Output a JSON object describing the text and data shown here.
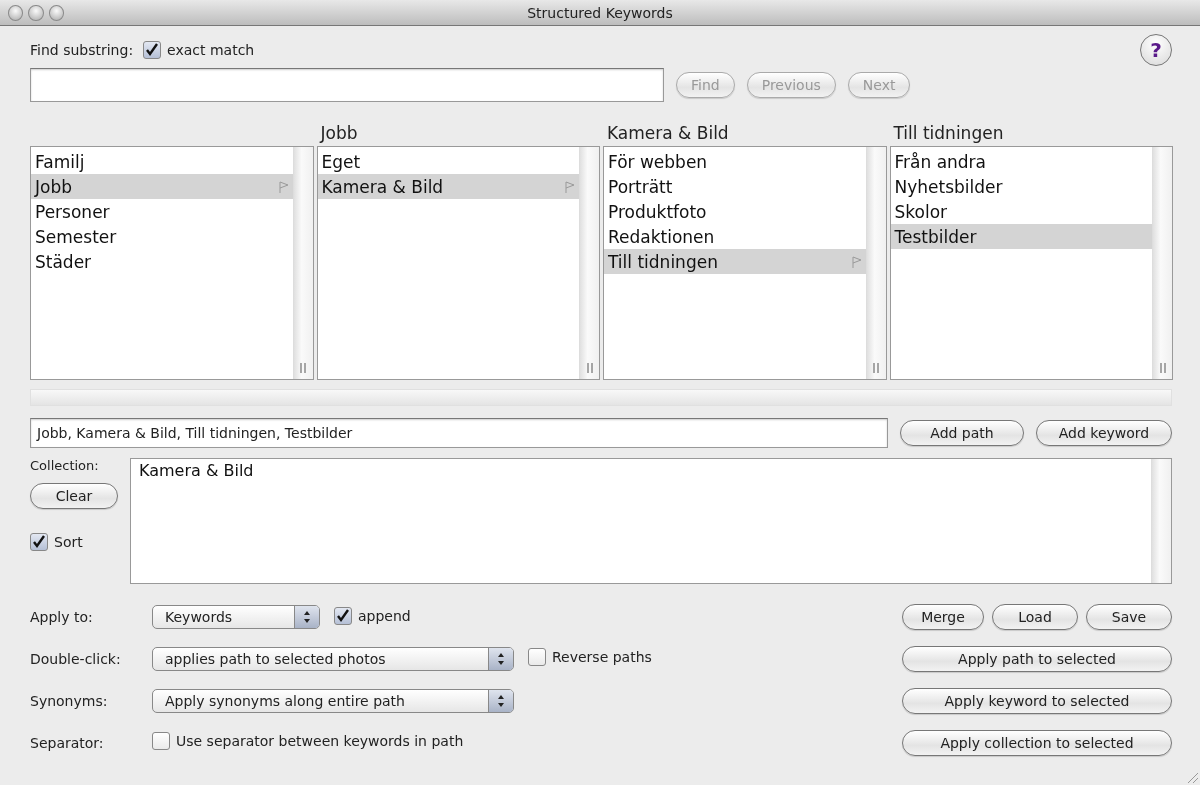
{
  "window": {
    "title": "Structured Keywords"
  },
  "find": {
    "label": "Find substring:",
    "exact_match": {
      "label": "exact match",
      "checked": true
    },
    "help": "?"
  },
  "find_buttons": [
    {
      "label": "Find",
      "disabled": true
    },
    {
      "label": "Previous",
      "disabled": true
    },
    {
      "label": "Next",
      "disabled": true
    }
  ],
  "columns": [
    {
      "items": [
        {
          "label": "Familj",
          "selected": false,
          "expanded": false
        },
        {
          "label": "Jobb",
          "selected": true,
          "expanded": true
        },
        {
          "label": "Personer",
          "selected": false,
          "expanded": false
        },
        {
          "label": "Semester",
          "selected": false,
          "expanded": false
        },
        {
          "label": "Städer",
          "selected": false,
          "expanded": false
        }
      ]
    },
    {
      "heading": "Jobb",
      "items": [
        {
          "label": "Eget",
          "selected": false,
          "expanded": false
        },
        {
          "label": "Kamera & Bild",
          "selected": true,
          "expanded": true
        }
      ]
    },
    {
      "heading": "Kamera & Bild",
      "items": [
        {
          "label": "För webben",
          "selected": false,
          "expanded": false
        },
        {
          "label": "Porträtt",
          "selected": false,
          "expanded": false
        },
        {
          "label": "Produktfoto",
          "selected": false,
          "expanded": false
        },
        {
          "label": "Redaktionen",
          "selected": false,
          "expanded": false
        },
        {
          "label": "Till tidningen",
          "selected": true,
          "expanded": true
        }
      ]
    },
    {
      "heading": "Till tidningen",
      "items": [
        {
          "label": "Från andra",
          "selected": false,
          "expanded": false
        },
        {
          "label": "Nyhetsbilder",
          "selected": false,
          "expanded": false
        },
        {
          "label": "Skolor",
          "selected": false,
          "expanded": false
        },
        {
          "label": "Testbilder",
          "selected": true,
          "expanded": false
        }
      ]
    }
  ],
  "path": {
    "value": "Jobb, Kamera & Bild, Till tidningen, Testbilder"
  },
  "path_buttons": [
    {
      "label": "Add path",
      "disabled": false
    },
    {
      "label": "Add keyword",
      "disabled": false
    }
  ],
  "collection": {
    "label": "Collection:",
    "clear": "Clear",
    "sort": {
      "label": "Sort",
      "checked": true
    },
    "items": [
      "Kamera & Bild"
    ]
  },
  "options": [
    {
      "kind": "select",
      "label": "Apply to:",
      "value": "Keywords",
      "checkbox": {
        "label": "append",
        "checked": true
      }
    },
    {
      "kind": "select",
      "label": "Double-click:",
      "value": "applies path to selected photos",
      "checkbox": {
        "label": "Reverse paths",
        "checked": false
      }
    },
    {
      "kind": "select",
      "label": "Synonyms:",
      "value": "Apply synonyms along entire path"
    },
    {
      "kind": "checkbox",
      "label": "Separator:",
      "checkbox": {
        "label": "Use separator between keywords in path",
        "checked": false
      }
    }
  ],
  "collection_buttons": [
    {
      "label": "Merge",
      "disabled": false
    },
    {
      "label": "Load",
      "disabled": false
    },
    {
      "label": "Save",
      "disabled": false
    }
  ],
  "apply_buttons": [
    {
      "label": "Apply path to selected",
      "disabled": false
    },
    {
      "label": "Apply keyword to selected",
      "disabled": false
    },
    {
      "label": "Apply collection to selected",
      "disabled": false
    }
  ]
}
